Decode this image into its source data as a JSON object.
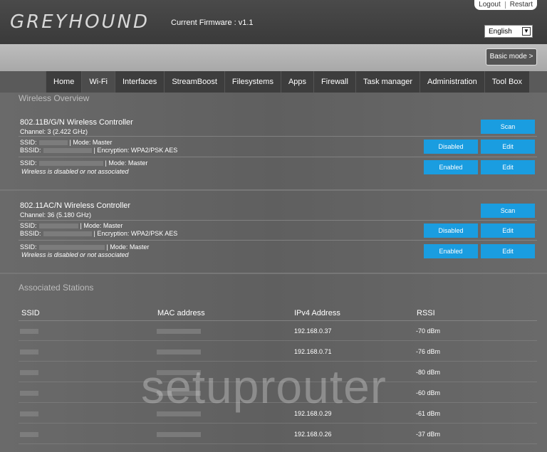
{
  "header": {
    "logo": "GREYHOUND",
    "firmware": "Current Firmware : v1.1",
    "logout": "Logout",
    "restart": "Restart",
    "language": "English",
    "basic_mode": "Basic mode >"
  },
  "nav": [
    "Home",
    "Wi-Fi",
    "Interfaces",
    "StreamBoost",
    "Filesystems",
    "Apps",
    "Firewall",
    "Task manager",
    "Administration",
    "Tool Box"
  ],
  "wireless_overview": {
    "title": "Wireless Overview",
    "controllers": [
      {
        "name": "802.11B/G/N Wireless Controller",
        "channel": "Channel: 3 (2.422 GHz)",
        "scan": "Scan",
        "networks": [
          {
            "ssid_label": "SSID:",
            "mode": "| Mode: Master",
            "bssid_label": "BSSID:",
            "encryption": "| Encryption: WPA2/PSK AES",
            "status_btn": "Disabled",
            "edit": "Edit"
          },
          {
            "ssid_label": "SSID:",
            "mode": "| Mode: Master",
            "note": "Wireless is disabled or not associated",
            "status_btn": "Enabled",
            "edit": "Edit"
          }
        ]
      },
      {
        "name": "802.11AC/N Wireless Controller",
        "channel": "Channel: 36 (5.180 GHz)",
        "scan": "Scan",
        "networks": [
          {
            "ssid_label": "SSID:",
            "mode": "| Mode: Master",
            "bssid_label": "BSSID:",
            "encryption": "| Encryption: WPA2/PSK AES",
            "status_btn": "Disabled",
            "edit": "Edit"
          },
          {
            "ssid_label": "SSID:",
            "mode": "| Mode: Master",
            "note": "Wireless is disabled or not associated",
            "status_btn": "Enabled",
            "edit": "Edit"
          }
        ]
      }
    ]
  },
  "stations": {
    "title": "Associated Stations",
    "headers": [
      "SSID",
      "MAC address",
      "IPv4 Address",
      "RSSI"
    ],
    "rows": [
      {
        "ip": "192.168.0.37",
        "rssi": "-70 dBm"
      },
      {
        "ip": "192.168.0.71",
        "rssi": "-76 dBm"
      },
      {
        "ip": "",
        "rssi": "-80 dBm"
      },
      {
        "ip": "",
        "rssi": "-60 dBm"
      },
      {
        "ip": "192.168.0.29",
        "rssi": "-61 dBm"
      },
      {
        "ip": "192.168.0.26",
        "rssi": "-37 dBm"
      }
    ]
  },
  "watermark": "setuprouter",
  "colors": {
    "accent_button": "#1a9de0"
  }
}
